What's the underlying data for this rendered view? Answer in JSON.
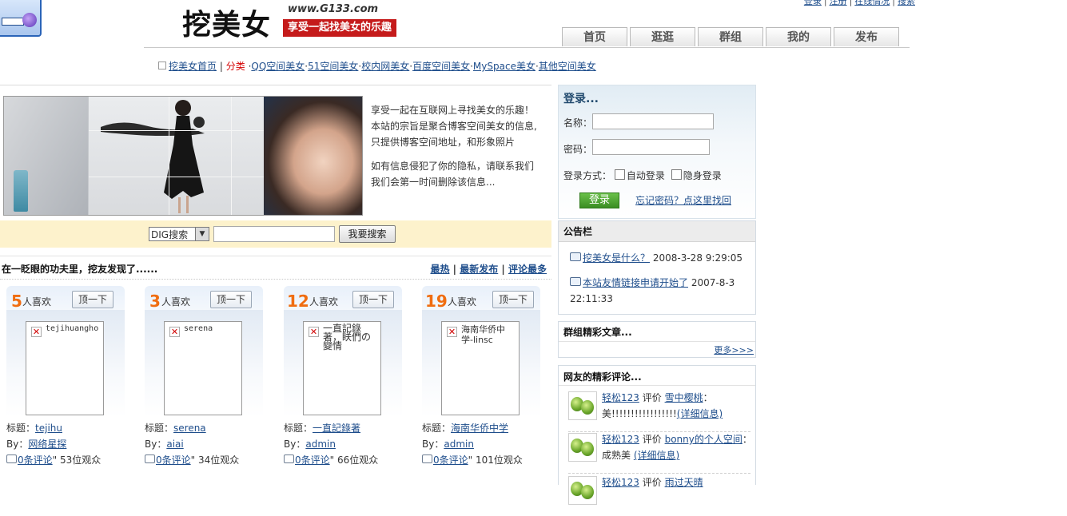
{
  "header": {
    "logo_text": "挖美女",
    "logo_url": "www.G133.com",
    "slogan": "享受一起找美女的乐趣",
    "top_links": [
      "登录",
      "注册",
      "在线情况",
      "搜索"
    ]
  },
  "nav": {
    "tabs": [
      "首页",
      "逛逛",
      "群组",
      "我的",
      "发布"
    ]
  },
  "breadcrumb": {
    "home": "挖美女首页",
    "category_label": "分类",
    "links": [
      "QQ空间美女",
      "51空间美女",
      "校内网美女",
      "百度空间美女",
      "MySpace美女",
      "其他空间美女"
    ]
  },
  "intro": {
    "para1_line1": "享受一起在互联网上寻找美女的乐趣！",
    "para1_line2": "本站的宗旨是聚合博客空间美女的信息,",
    "para1_line3": "只提供博客空间地址，和形象照片",
    "para2_line1": "如有信息侵犯了你的隐私，请联系我们",
    "para2_line2": "我们会第一时间删除该信息..."
  },
  "search": {
    "select_value": "DIG搜索",
    "input_value": "",
    "button_label": "我要搜索"
  },
  "discover": {
    "title": "在一眨眼的功夫里，挖友发现了......",
    "sort_hot": "最热",
    "sort_new": "最新发布",
    "sort_comments": "评论最多"
  },
  "cards": [
    {
      "count": "5",
      "like_label": "人喜欢",
      "button": "顶一下",
      "alt": "tejihuangho",
      "title_label": "标题：",
      "title": "tejihu",
      "by_label": "By：",
      "author": "网络星探",
      "comments": "0条评论",
      "views": "53位观众"
    },
    {
      "count": "3",
      "like_label": "人喜欢",
      "button": "顶一下",
      "alt": "serena",
      "title_label": "标题：",
      "title": "serena",
      "by_label": "By：",
      "author": "aiai",
      "comments": "0条评论",
      "views": "34位观众"
    },
    {
      "count": "12",
      "like_label": "人喜欢",
      "button": "顶一下",
      "alt": "一直記錄著，眹們の變情",
      "title_label": "标题：",
      "title": "一直記錄著",
      "by_label": "By：",
      "author": "admin",
      "comments": "0条评论",
      "views": "66位观众"
    },
    {
      "count": "19",
      "like_label": "人喜欢",
      "button": "顶一下",
      "alt": "海南华侨中学-linsc",
      "title_label": "标题：",
      "title": "海南华侨中学",
      "by_label": "By：",
      "author": "admin",
      "comments": "0条评论",
      "views": "101位观众"
    }
  ],
  "login": {
    "title": "登录...",
    "name_label": "名称：",
    "name_value": "",
    "password_label": "密码：",
    "password_value": "",
    "mode_label": "登录方式：",
    "auto_login": "自动登录",
    "invisible_login": "隐身登录",
    "button": "登录",
    "forgot": "忘记密码？点这里找回"
  },
  "notice": {
    "title": "公告栏",
    "items": [
      {
        "link": "挖美女是什么？",
        "date": "2008-3-28 9:29:05"
      },
      {
        "link": "本站友情链接申请开始了",
        "date": "2007-8-3 22:11:33"
      }
    ]
  },
  "group": {
    "title": "群组精彩文章...",
    "more": "更多>>>"
  },
  "reviews": {
    "title": "网友的精彩评论...",
    "items": [
      {
        "user": "轻松123",
        "verb": "评价",
        "target": "雪中樱桃",
        "colon": "：",
        "text": "美!!!!!!!!!!!!!!!!!",
        "detail": "(详细信息)"
      },
      {
        "user": "轻松123",
        "verb": "评价",
        "target": "bonny的个人空间",
        "colon": "：",
        "text": "成熟美",
        "detail": "(详细信息)"
      },
      {
        "user": "轻松123",
        "verb": "评价",
        "target": "雨过天晴",
        "colon": "：",
        "text": "",
        "detail": ""
      }
    ]
  },
  "colors": {
    "slogan_bg": "#c51b1b",
    "count_orange": "#f06d10",
    "link_blue": "#1f4e8c",
    "search_bar_bg": "#fdf2cc",
    "login_button": "#4fa632"
  }
}
